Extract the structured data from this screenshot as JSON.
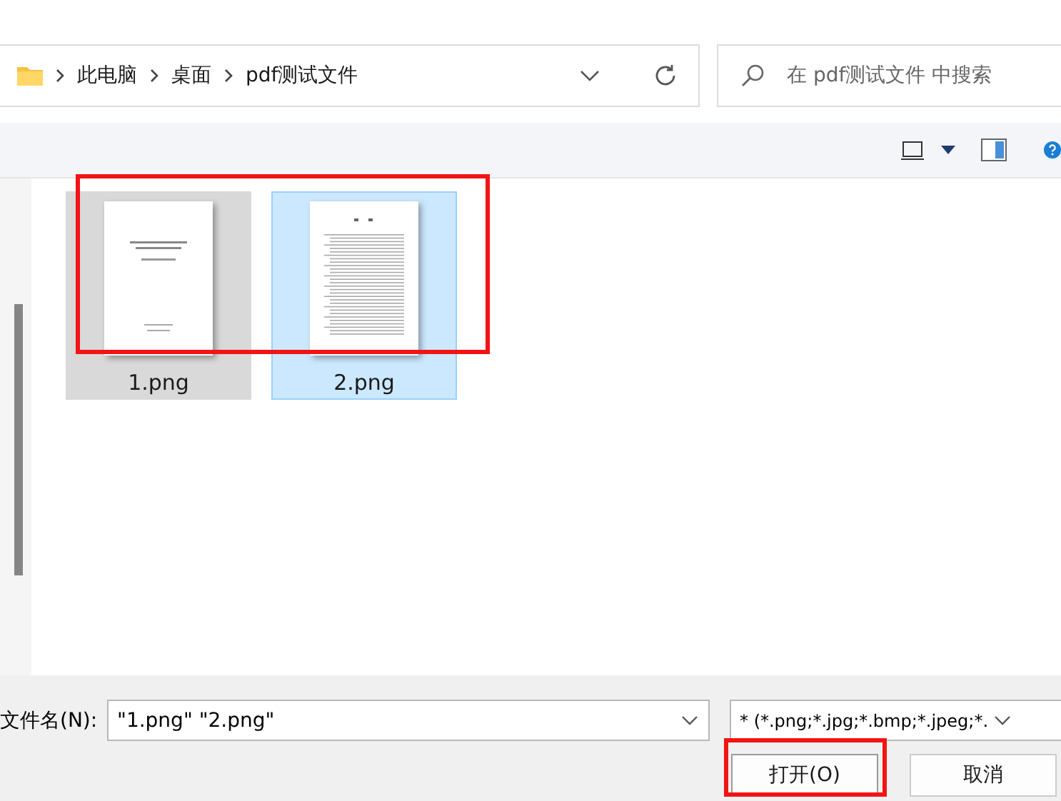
{
  "address_bar": {
    "path": [
      "此电脑",
      "桌面",
      "pdf测试文件"
    ]
  },
  "search": {
    "placeholder": "在 pdf测试文件 中搜索"
  },
  "files": [
    {
      "name": "1.png",
      "selected": true,
      "focused": false,
      "kind": "cover"
    },
    {
      "name": "2.png",
      "selected": true,
      "focused": true,
      "kind": "contents"
    }
  ],
  "filename": {
    "label": "文件名(N):",
    "value": "\"1.png\" \"2.png\""
  },
  "filter": {
    "value": "* (*.png;*.jpg;*.bmp;*.jpeg;*."
  },
  "buttons": [
    {
      "label": "打开(O)",
      "kind": "primary"
    },
    {
      "label": "取消",
      "kind": "secondary"
    }
  ]
}
